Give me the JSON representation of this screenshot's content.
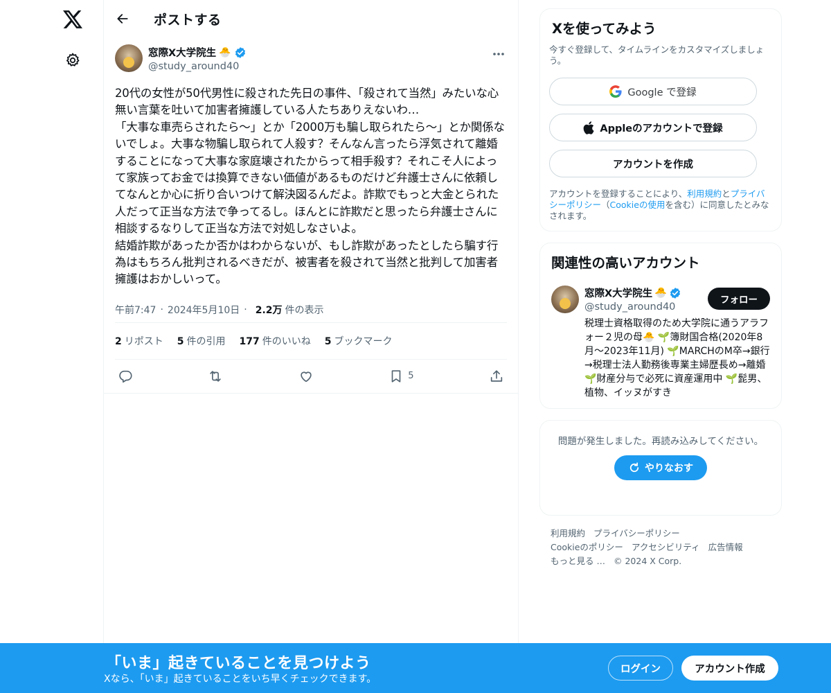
{
  "nav": {
    "logo_icon": "x-logo-icon",
    "settings_icon": "gear-icon"
  },
  "header": {
    "title": "ポストする"
  },
  "post": {
    "author": {
      "name": "窓際X大学院生",
      "emoji": "🐣",
      "handle": "@study_around40",
      "verified": true
    },
    "text": "20代の女性が50代男性に殺された先日の事件、「殺されて当然」みたいな心無い言葉を吐いて加害者擁護している人たちありえないわ…\n「大事な車売らされたら〜」とか「2000万も騙し取られたら〜」とか関係ないでしょ。大事な物騙し取られて人殺す？そんなん言ったら浮気されて離婚することになって大事な家庭壊されたからって相手殺す？それこそ人によって家族ってお金では換算できない価値があるものだけど弁護士さんに依頼してなんとか心に折り合いつけて解決図るんだよ。詐欺でもっと大金とられた人だって正当な方法で争ってるし。ほんとに詐欺だと思ったら弁護士さんに相談するなりして正当な方法で対処しなさいよ。\n結婚詐欺があったか否かはわからないが、もし詐欺があったとしたら騙す行為はもちろん批判されるべきだが、被害者を殺されて当然と批判して加害者擁護はおかしいって。",
    "time": "午前7:47",
    "date": "2024年5月10日",
    "views": "2.2万",
    "views_label": "件の表示",
    "stats": {
      "reposts_num": "2",
      "reposts_label": "リポスト",
      "quotes_num": "5",
      "quotes_label": "件の引用",
      "likes_num": "177",
      "likes_label": "件のいいね",
      "bookmarks_num": "5",
      "bookmarks_label": "ブックマーク"
    },
    "bookmark_count": "5"
  },
  "signup_card": {
    "title": "Xを使ってみよう",
    "subtitle": "今すぐ登録して、タイムラインをカスタマイズしましょう。",
    "google_label": "Google で登録",
    "apple_label": "Appleのアカウントで登録",
    "create_label": "アカウントを作成",
    "legal_prefix": "アカウントを登録することにより、",
    "legal_terms": "利用規約",
    "legal_and": "と",
    "legal_privacy": "プライバシーポリシー",
    "legal_paren_open": "（",
    "legal_cookie": "Cookieの使用",
    "legal_suffix": "を含む）に同意したとみなされます。"
  },
  "related": {
    "title": "関連性の高いアカウント",
    "name": "窓際X大学院生",
    "emoji": "🐣",
    "handle": "@study_around40",
    "follow_label": "フォロー",
    "bio": "税理士資格取得のため大学院に通うアラフォー２児の母🐣 🌱簿財国合格(2020年8月〜2023年11月) 🌱MARCHのM卒→銀行→税理士法人勤務後専業主婦歴長め→離婚 🌱財産分与で必死に資産運用中 🌱髭男、植物、イッヌがすき"
  },
  "error_card": {
    "message": "問題が発生しました。再読み込みしてください。",
    "retry_label": "やりなおす"
  },
  "footer": {
    "terms": "利用規約",
    "privacy": "プライバシーポリシー",
    "cookie": "Cookieのポリシー",
    "accessibility": "アクセシビリティ",
    "ads": "広告情報",
    "more": "もっと見る …",
    "copyright": "© 2024 X Corp."
  },
  "bottom_bar": {
    "title": "「いま」起きていることを見つけよう",
    "subtitle": "Xなら、「いま」起きていることをいち早くチェックできます。",
    "login_label": "ログイン",
    "signup_label": "アカウント作成"
  },
  "colors": {
    "accent": "#1d9bf0",
    "text": "#0f1419",
    "secondary": "#536471",
    "border": "#eff3f4"
  }
}
